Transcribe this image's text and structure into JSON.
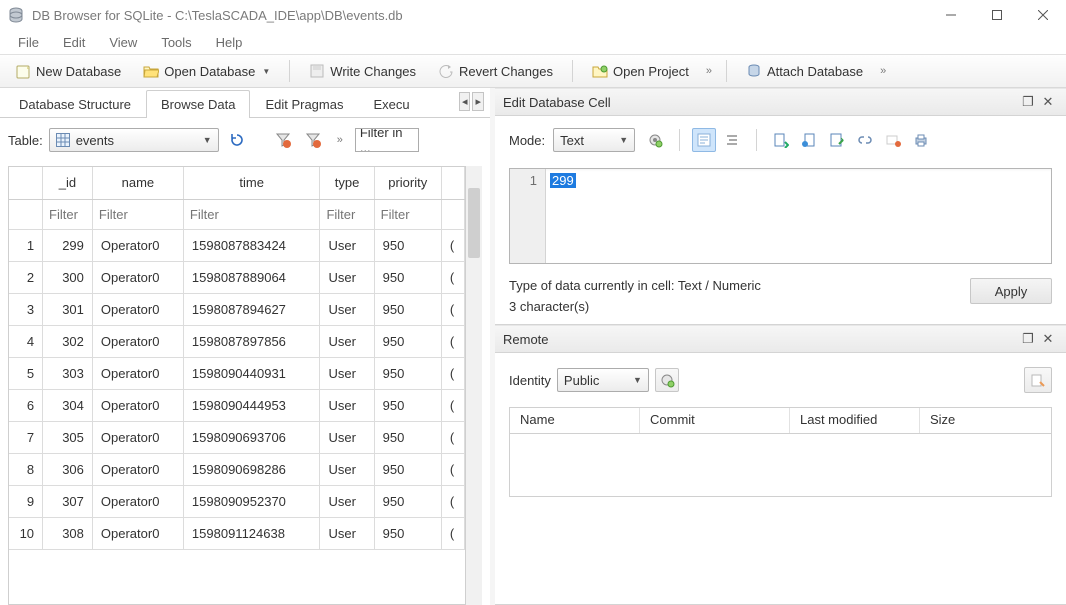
{
  "titlebar": {
    "text": "DB Browser for SQLite - C:\\TeslaSCADA_IDE\\app\\DB\\events.db"
  },
  "menu": {
    "file": "File",
    "edit": "Edit",
    "view": "View",
    "tools": "Tools",
    "help": "Help"
  },
  "toolbar": {
    "new_db": "New Database",
    "open_db": "Open Database",
    "write": "Write Changes",
    "revert": "Revert Changes",
    "open_project": "Open Project",
    "attach": "Attach Database"
  },
  "more": "»",
  "tabs": {
    "structure": "Database Structure",
    "browse": "Browse Data",
    "pragmas": "Edit Pragmas",
    "execute": "Execu"
  },
  "table_tb": {
    "label": "Table:",
    "selected": "events",
    "filter_placeholder": "Filter in ..."
  },
  "grid": {
    "headers": {
      "_id": "_id",
      "name": "name",
      "time": "time",
      "type": "type",
      "priority": "priority"
    },
    "filter_placeholder": "Filter",
    "rows": [
      {
        "n": "1",
        "_id": "299",
        "name": "Operator0",
        "time": "1598087883424",
        "type": "User",
        "priority": "950"
      },
      {
        "n": "2",
        "_id": "300",
        "name": "Operator0",
        "time": "1598087889064",
        "type": "User",
        "priority": "950"
      },
      {
        "n": "3",
        "_id": "301",
        "name": "Operator0",
        "time": "1598087894627",
        "type": "User",
        "priority": "950"
      },
      {
        "n": "4",
        "_id": "302",
        "name": "Operator0",
        "time": "1598087897856",
        "type": "User",
        "priority": "950"
      },
      {
        "n": "5",
        "_id": "303",
        "name": "Operator0",
        "time": "1598090440931",
        "type": "User",
        "priority": "950"
      },
      {
        "n": "6",
        "_id": "304",
        "name": "Operator0",
        "time": "1598090444953",
        "type": "User",
        "priority": "950"
      },
      {
        "n": "7",
        "_id": "305",
        "name": "Operator0",
        "time": "1598090693706",
        "type": "User",
        "priority": "950"
      },
      {
        "n": "8",
        "_id": "306",
        "name": "Operator0",
        "time": "1598090698286",
        "type": "User",
        "priority": "950"
      },
      {
        "n": "9",
        "_id": "307",
        "name": "Operator0",
        "time": "1598090952370",
        "type": "User",
        "priority": "950"
      },
      {
        "n": "10",
        "_id": "308",
        "name": "Operator0",
        "time": "1598091124638",
        "type": "User",
        "priority": "950"
      }
    ]
  },
  "edit_cell": {
    "title": "Edit Database Cell",
    "mode_label": "Mode:",
    "mode_value": "Text",
    "line_no": "1",
    "value": "299",
    "type_line": "Type of data currently in cell: Text / Numeric",
    "char_line": "3 character(s)",
    "apply": "Apply"
  },
  "remote": {
    "title": "Remote",
    "identity_label": "Identity",
    "identity_value": "Public",
    "cols": {
      "name": "Name",
      "commit": "Commit",
      "last": "Last modified",
      "size": "Size"
    }
  }
}
